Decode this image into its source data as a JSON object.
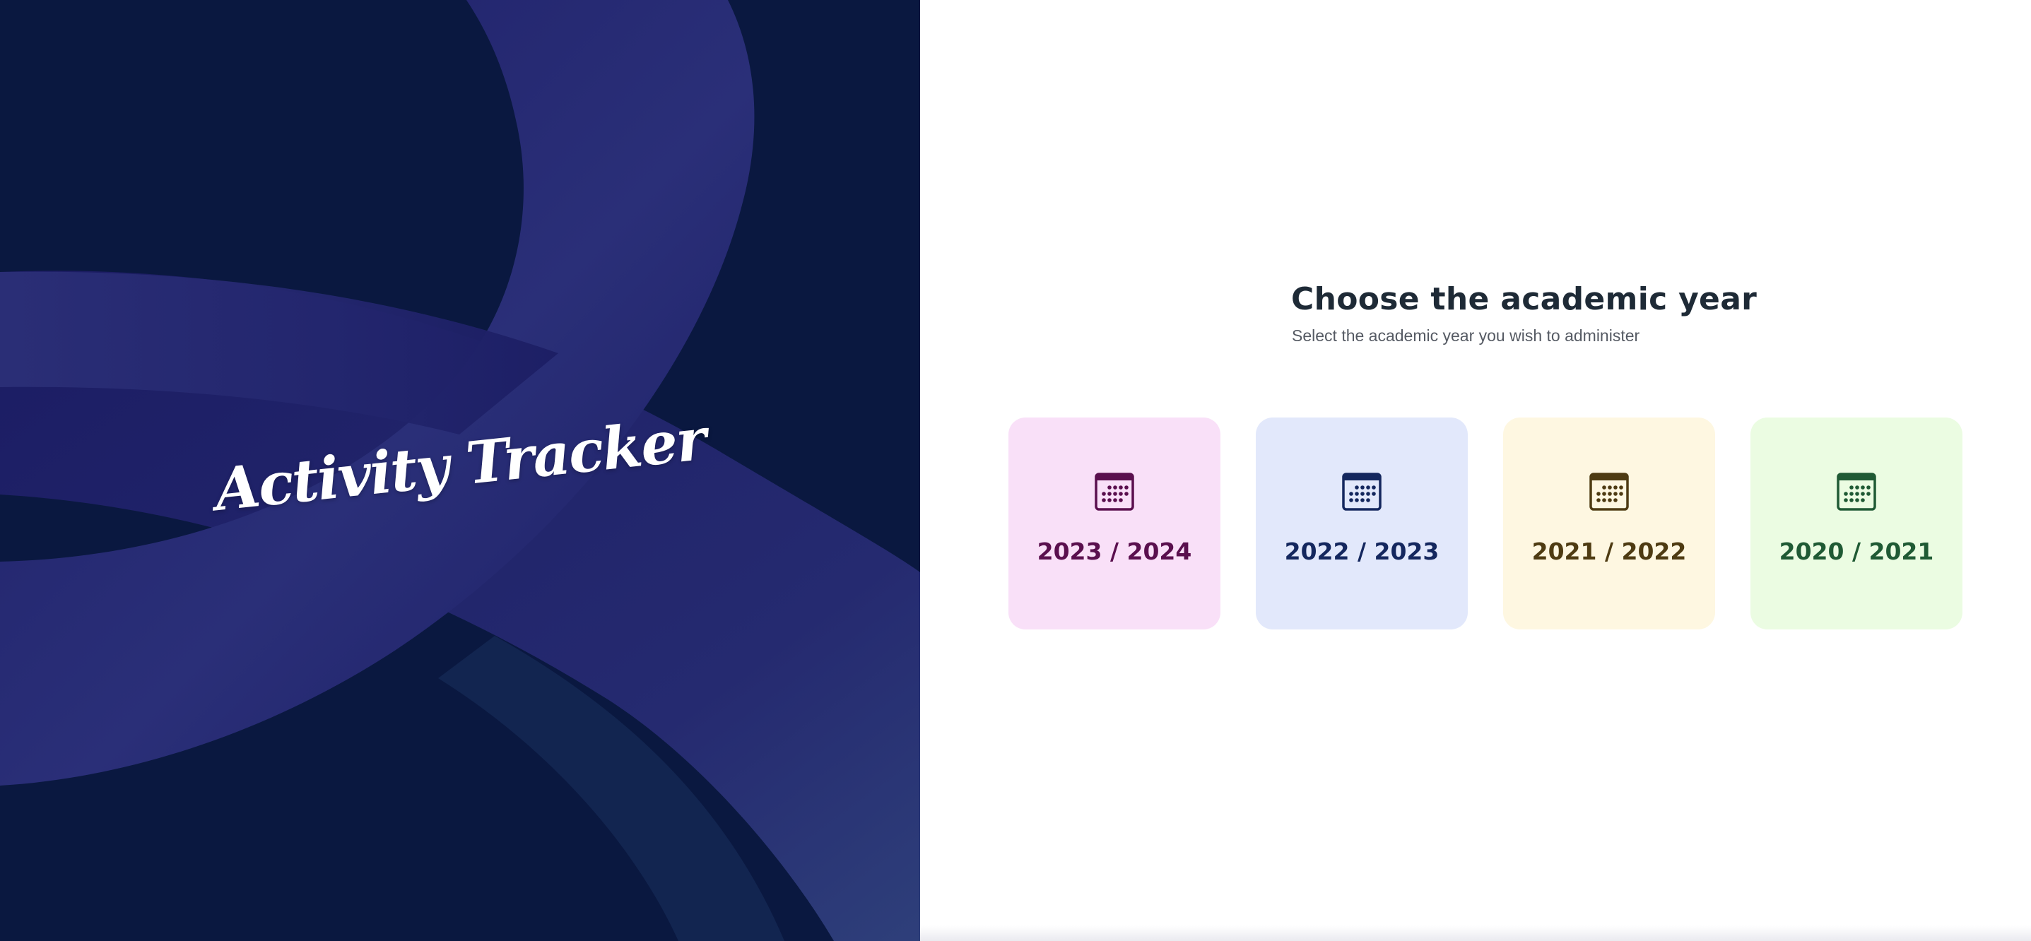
{
  "brand": {
    "logo_text": "Activity Tracker"
  },
  "header": {
    "title": "Choose the academic year",
    "subtitle": "Select the academic year you wish to administer"
  },
  "years": [
    {
      "label": "2023 / 2024",
      "icon": "calendar-icon",
      "bg": "#f9e0f8",
      "fg": "#5a0f4e"
    },
    {
      "label": "2022 / 2023",
      "icon": "calendar-icon",
      "bg": "#e2e8fb",
      "fg": "#14275e"
    },
    {
      "label": "2021 / 2022",
      "icon": "calendar-icon",
      "bg": "#fef7e1",
      "fg": "#4e3b12"
    },
    {
      "label": "2020 / 2021",
      "icon": "calendar-icon",
      "bg": "#ebfce2",
      "fg": "#1f5a34"
    }
  ],
  "colors": {
    "hero_bg": "#0a1840",
    "hero_ribbon": "#1d1e6b",
    "heading": "#1e2a36",
    "subheading": "#555a63"
  }
}
